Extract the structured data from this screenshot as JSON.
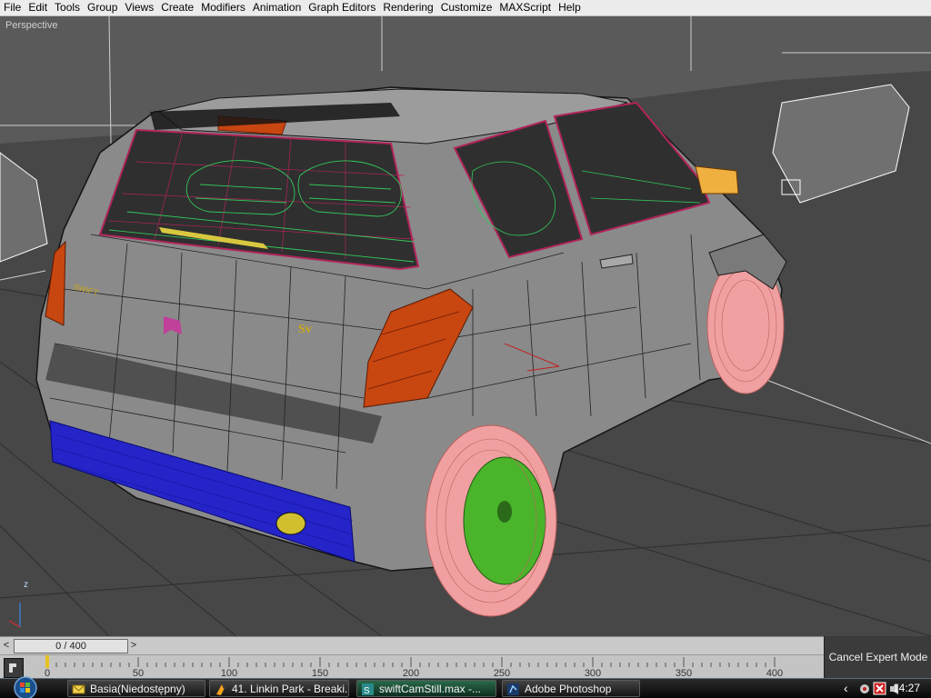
{
  "menubar": {
    "items": [
      {
        "label": "File"
      },
      {
        "label": "Edit"
      },
      {
        "label": "Tools"
      },
      {
        "label": "Group"
      },
      {
        "label": "Views"
      },
      {
        "label": "Create"
      },
      {
        "label": "Modifiers"
      },
      {
        "label": "Animation"
      },
      {
        "label": "Graph Editors"
      },
      {
        "label": "Rendering"
      },
      {
        "label": "Customize"
      },
      {
        "label": "MAXScript"
      },
      {
        "label": "Help"
      }
    ]
  },
  "viewport": {
    "label": "Perspective",
    "axis_label": "z"
  },
  "timeslider": {
    "prev": "<",
    "position": "0 / 400",
    "next": ">"
  },
  "trackbar": {
    "ticks": [
      "0",
      "50",
      "100",
      "150",
      "200",
      "250",
      "300",
      "350",
      "400"
    ]
  },
  "expert_button": "Cancel Expert Mode",
  "taskbar": {
    "tasks": [
      {
        "label": "Basia(Niedostępny)",
        "icon": "mail-icon"
      },
      {
        "label": "41. Linkin Park - Breaki...",
        "icon": "winamp-icon"
      },
      {
        "label": "swiftCamStill.max    -...",
        "icon": "3dsmax-icon"
      },
      {
        "label": "Adobe Photoshop",
        "icon": "photoshop-icon"
      }
    ],
    "tray_chevron": "‹",
    "clock": "14:27"
  },
  "colors": {
    "menubar": "#ececec",
    "viewport": "#474747",
    "car_body": "#8a8a8a",
    "wireframe_glass": "#b0245a",
    "interior_wire": "#32c85a",
    "tire": "#f0a0a0",
    "rim": "#4ab52a",
    "bumper_blue": "#2424c8",
    "taillight": "#c84610"
  }
}
